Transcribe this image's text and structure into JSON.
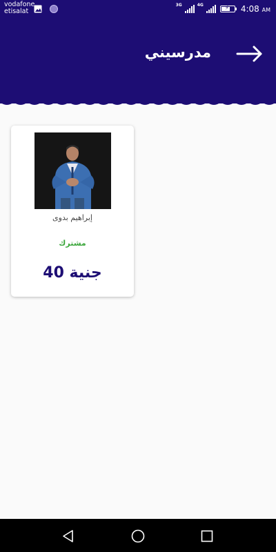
{
  "status_bar": {
    "carrier_line1": "vodafone",
    "carrier_line2": "etisalat",
    "network1": "3G",
    "network2": "4G",
    "time": "4:08",
    "ampm": "AM"
  },
  "header": {
    "title": "مدرسيني",
    "back_icon": "arrow-right-icon"
  },
  "teachers": [
    {
      "name": "إبراهيم بدوى",
      "status": "مشترك",
      "price": "جنية 40"
    }
  ],
  "colors": {
    "primary": "#1d0d74",
    "subscribed": "#3aa63a",
    "background": "#fafafa"
  },
  "nav": {
    "back_icon": "triangle-back-icon",
    "home_icon": "circle-home-icon",
    "recents_icon": "square-recents-icon"
  }
}
